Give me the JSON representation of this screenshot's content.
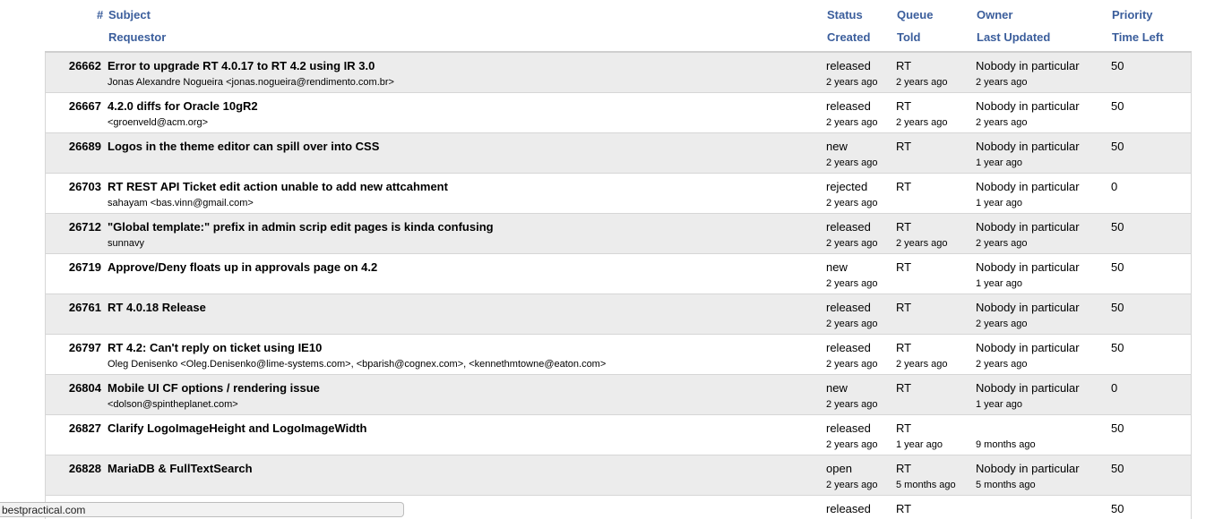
{
  "header": {
    "hash": "#",
    "subject": "Subject",
    "requestor": "Requestor",
    "status": "Status",
    "created": "Created",
    "queue": "Queue",
    "told": "Told",
    "owner": "Owner",
    "last_updated": "Last Updated",
    "priority": "Priority",
    "time_left": "Time Left"
  },
  "tickets": [
    {
      "id": "26662",
      "subject": "Error to upgrade RT 4.0.17 to RT 4.2 using IR 3.0",
      "requestor": "Jonas Alexandre Nogueira <jonas.nogueira@rendimento.com.br>",
      "status": "released",
      "created": "2 years ago",
      "queue": "RT",
      "told": "2 years ago",
      "owner": "Nobody in particular",
      "last_updated": "2 years ago",
      "priority": "50"
    },
    {
      "id": "26667",
      "subject": "4.2.0 diffs for Oracle 10gR2",
      "requestor": "<groenveld@acm.org>",
      "status": "released",
      "created": "2 years ago",
      "queue": "RT",
      "told": "2 years ago",
      "owner": "Nobody in particular",
      "last_updated": "2 years ago",
      "priority": "50"
    },
    {
      "id": "26689",
      "subject": "Logos in the theme editor can spill over into CSS",
      "requestor": "",
      "status": "new",
      "created": "2 years ago",
      "queue": "RT",
      "told": "",
      "owner": "Nobody in particular",
      "last_updated": "1 year ago",
      "priority": "50"
    },
    {
      "id": "26703",
      "subject": "RT REST API Ticket edit action unable to add new attcahment",
      "requestor": "sahayam <bas.vinn@gmail.com>",
      "status": "rejected",
      "created": "2 years ago",
      "queue": "RT",
      "told": "",
      "owner": "Nobody in particular",
      "last_updated": "1 year ago",
      "priority": "0"
    },
    {
      "id": "26712",
      "subject": "\"Global template:\" prefix in admin scrip edit pages is kinda confusing",
      "requestor": "sunnavy",
      "status": "released",
      "created": "2 years ago",
      "queue": "RT",
      "told": "2 years ago",
      "owner": "Nobody in particular",
      "last_updated": "2 years ago",
      "priority": "50"
    },
    {
      "id": "26719",
      "subject": "Approve/Deny floats up in approvals page on 4.2",
      "requestor": "",
      "status": "new",
      "created": "2 years ago",
      "queue": "RT",
      "told": "",
      "owner": "Nobody in particular",
      "last_updated": "1 year ago",
      "priority": "50"
    },
    {
      "id": "26761",
      "subject": "RT 4.0.18 Release",
      "requestor": "",
      "status": "released",
      "created": "2 years ago",
      "queue": "RT",
      "told": "",
      "owner": "Nobody in particular",
      "last_updated": "2 years ago",
      "priority": "50"
    },
    {
      "id": "26797",
      "subject": "RT 4.2: Can't reply on ticket using IE10",
      "requestor": "Oleg Denisenko <Oleg.Denisenko@lime-systems.com>, <bparish@cognex.com>, <kennethmtowne@eaton.com>",
      "status": "released",
      "created": "2 years ago",
      "queue": "RT",
      "told": "2 years ago",
      "owner": "Nobody in particular",
      "last_updated": "2 years ago",
      "priority": "50"
    },
    {
      "id": "26804",
      "subject": "Mobile UI CF options / rendering issue",
      "requestor": "<dolson@spintheplanet.com>",
      "status": "new",
      "created": "2 years ago",
      "queue": "RT",
      "told": "",
      "owner": "Nobody in particular",
      "last_updated": "1 year ago",
      "priority": "0"
    },
    {
      "id": "26827",
      "subject": "Clarify LogoImageHeight and LogoImageWidth",
      "requestor": "",
      "status": "released",
      "created": "2 years ago",
      "queue": "RT",
      "told": "1 year ago",
      "owner": "",
      "last_updated": "9 months ago",
      "priority": "50"
    },
    {
      "id": "26828",
      "subject": "MariaDB & FullTextSearch",
      "requestor": "",
      "status": "open",
      "created": "2 years ago",
      "queue": "RT",
      "told": "5 months ago",
      "owner": "Nobody in particular",
      "last_updated": "5 months ago",
      "priority": "50"
    },
    {
      "id": "",
      "subject": "",
      "requestor": "",
      "status": "released",
      "created": "",
      "queue": "RT",
      "told": "",
      "owner": "",
      "last_updated": "",
      "priority": "50"
    }
  ],
  "statusbar": {
    "url": "bestpractical.com"
  },
  "colors": {
    "header_link": "#3b5e9c",
    "row_odd": "#ececec",
    "row_even": "#ffffff"
  }
}
